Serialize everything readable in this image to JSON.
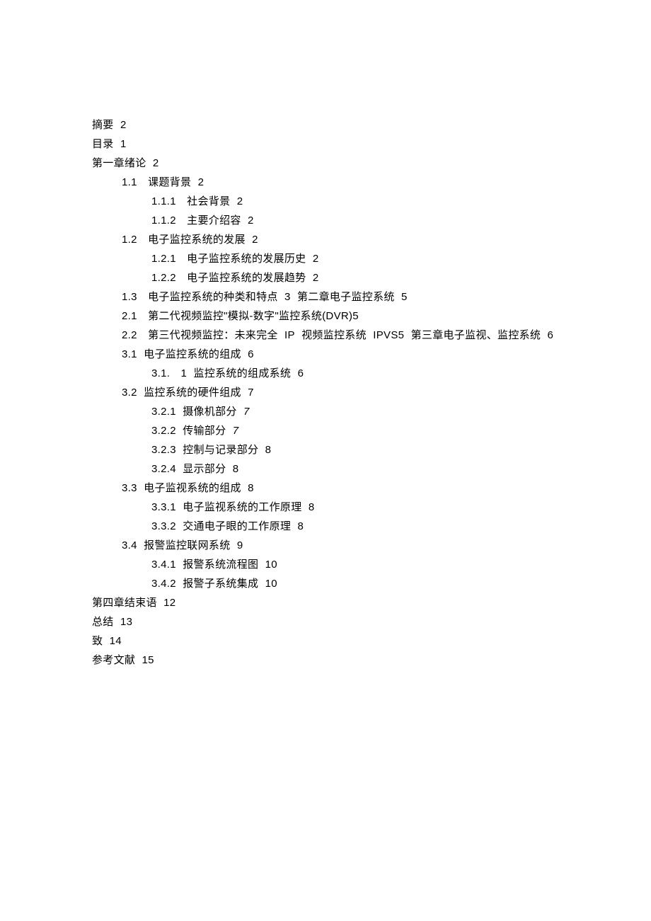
{
  "toc": [
    {
      "level": 0,
      "text": "摘要 2"
    },
    {
      "level": 0,
      "text": "目录 1"
    },
    {
      "level": 0,
      "text": "第一章绪论 2"
    },
    {
      "level": 1,
      "text": "1.1　课题背景 2"
    },
    {
      "level": 2,
      "text": "1.1.1　社会背景 2"
    },
    {
      "level": 2,
      "text": "1.1.2　主要介绍容 2"
    },
    {
      "level": 1,
      "text": "1.2　电子监控系统的发展 2"
    },
    {
      "level": 2,
      "text": "1.2.1　电子监控系统的发展历史 2"
    },
    {
      "level": 2,
      "text": "1.2.2　电子监控系统的发展趋势 2"
    },
    {
      "level": 1,
      "text": "1.3　电子监控系统的种类和特点 3 第二章电子监控系统 5"
    },
    {
      "level": 1,
      "text": "2.1　第二代视频监控\"模拟-数字\"监控系统(DVR)5"
    },
    {
      "level": 1,
      "text": "2.2　第三代视频监控：未来完全 IP 视频监控系统 IPVS5 第三章电子监视、监控系统 6"
    },
    {
      "level": 1,
      "text": "3.1 电子监控系统的组成 6"
    },
    {
      "level": 2,
      "text": "3.1.　1 监控系统的组成系统 6"
    },
    {
      "level": 1,
      "text": "3.2 监控系统的硬件组成 7"
    },
    {
      "level": 2,
      "text": "3.2.1 摄像机部分 7",
      "italic_suffix": "7"
    },
    {
      "level": 2,
      "text": "3.2.2 传输部分 7",
      "italic_suffix": "7"
    },
    {
      "level": 2,
      "text": "3.2.3 控制与记录部分 8"
    },
    {
      "level": 2,
      "text": "3.2.4 显示部分 8"
    },
    {
      "level": 1,
      "text": "3.3 电子监视系统的组成 8"
    },
    {
      "level": 2,
      "text": "3.3.1 电子监视系统的工作原理 8"
    },
    {
      "level": 2,
      "text": "3.3.2 交通电子眼的工作原理 8"
    },
    {
      "level": 1,
      "text": "3.4 报警监控联网系统 9"
    },
    {
      "level": 2,
      "text": "3.4.1 报警系统流程图 10"
    },
    {
      "level": 2,
      "text": "3.4.2 报警子系统集成 10"
    },
    {
      "level": 0,
      "text": "第四章结束语 12"
    },
    {
      "level": 0,
      "text": "总结 13"
    },
    {
      "level": 0,
      "text": "致 14"
    },
    {
      "level": 0,
      "text": "参考文献 15"
    }
  ]
}
